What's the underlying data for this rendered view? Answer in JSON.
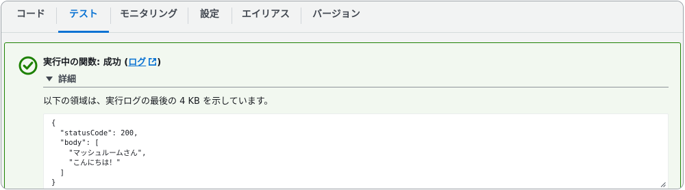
{
  "tabs": [
    {
      "label": "コード",
      "active": false
    },
    {
      "label": "テスト",
      "active": true
    },
    {
      "label": "モニタリング",
      "active": false
    },
    {
      "label": "設定",
      "active": false
    },
    {
      "label": "エイリアス",
      "active": false
    },
    {
      "label": "バージョン",
      "active": false
    }
  ],
  "result": {
    "status_prefix": "実行中の関数: 成功 (",
    "log_link": "ログ",
    "status_suffix": ")",
    "details_label": "詳細",
    "description": "以下の領域は、実行ログの最後の 4 KB を示しています。",
    "output": "{\n  \"statusCode\": 200,\n  \"body\": [\n    \"マッシュルームさん\",\n    \"こんにちは！\"\n  ]\n}"
  },
  "icons": {
    "status": "check-circle-icon",
    "external_link": "external-link-icon",
    "expand": "caret-down-icon",
    "resize": "resize-handle-icon"
  },
  "colors": {
    "accent": "#0972d3",
    "success": "#1d8102",
    "success_bg": "#f2f8f0"
  }
}
